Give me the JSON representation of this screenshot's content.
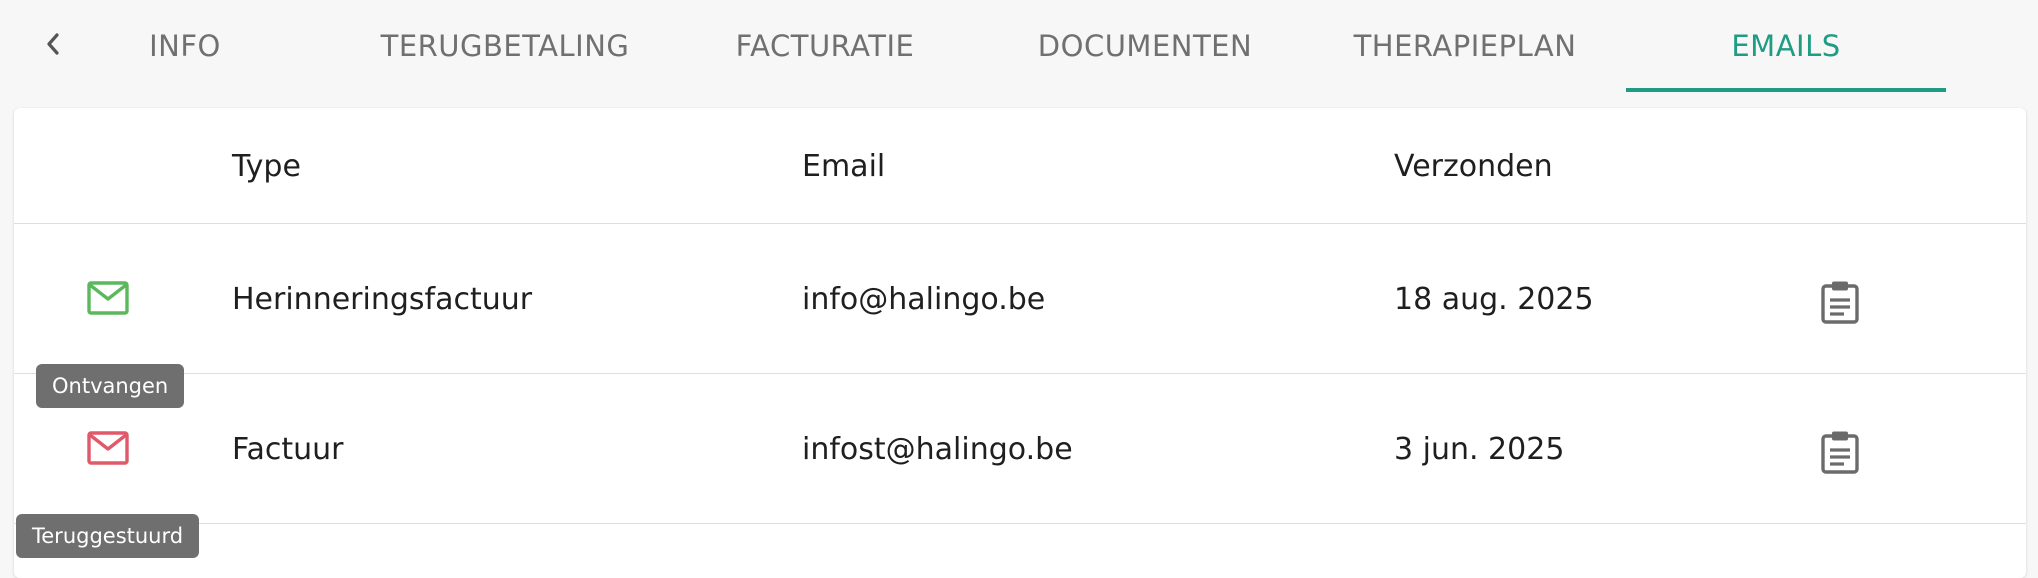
{
  "tabs": [
    {
      "label": "INFO",
      "active": false
    },
    {
      "label": "TERUGBETALING",
      "active": false
    },
    {
      "label": "FACTURATIE",
      "active": false
    },
    {
      "label": "DOCUMENTEN",
      "active": false
    },
    {
      "label": "THERAPIEPLAN",
      "active": false
    },
    {
      "label": "EMAILS",
      "active": true
    }
  ],
  "table": {
    "headers": {
      "type": "Type",
      "email": "Email",
      "sent": "Verzonden"
    },
    "rows": [
      {
        "status": "Ontvangen",
        "status_color": "#5cb85c",
        "type": "Herinneringsfactuur",
        "email": "info@halingo.be",
        "sent": "18 aug. 2025",
        "icon": "mail-icon"
      },
      {
        "status": "Teruggestuurd",
        "status_color": "#e0596a",
        "type": "Factuur",
        "email": "infost@halingo.be",
        "sent": "3 jun. 2025",
        "icon": "mail-icon"
      }
    ]
  },
  "tooltips": {
    "row0": "Ontvangen",
    "row1": "Teruggestuurd"
  },
  "colors": {
    "accent": "#1f9c83",
    "received": "#5cb85c",
    "returned": "#e0596a",
    "tooltip_bg": "#6f6f6f"
  },
  "icons": {
    "back": "chevron-left-icon",
    "copy": "clipboard-icon"
  }
}
